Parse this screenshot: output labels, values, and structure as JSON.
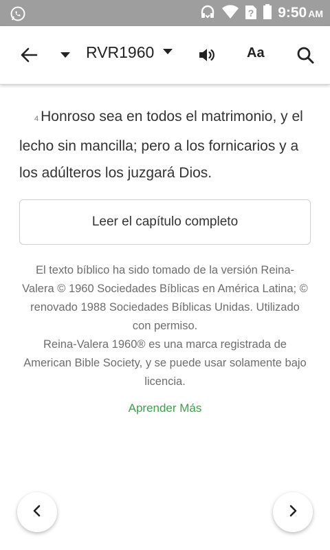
{
  "status_bar": {
    "time": "9:50",
    "ampm": "AM",
    "icons": [
      "whatsapp-icon",
      "headset-icon",
      "wifi-icon",
      "no-sim-icon",
      "battery-icon"
    ]
  },
  "toolbar": {
    "version": "RVR1960",
    "font_button": "Aa",
    "icons": [
      "back-arrow-icon",
      "chevron-down-icon",
      "audio-icon",
      "search-icon"
    ]
  },
  "verse": {
    "number": "4",
    "text": "Honroso sea en todos el matrimonio, y el lecho sin mancilla; pero a los fornicarios y a los adúlteros los juzgará Dios."
  },
  "read_chapter_label": "Leer el capítulo completo",
  "copyright": {
    "line1": "El texto bíblico ha sido tomado de la versión Reina-Valera © 1960 Sociedades Bíblicas en América Latina; © renovado 1988 Sociedades Bíblicas Unidas. Utilizado con permiso.",
    "line2": "Reina-Valera 1960® es una marca registrada de American Bible Society, y se puede usar solamente bajo licencia."
  },
  "learn_more": "Aprender Más",
  "colors": {
    "status_bar": "#9e9e9e",
    "link_green": "#3aa147",
    "text": "#333333"
  }
}
